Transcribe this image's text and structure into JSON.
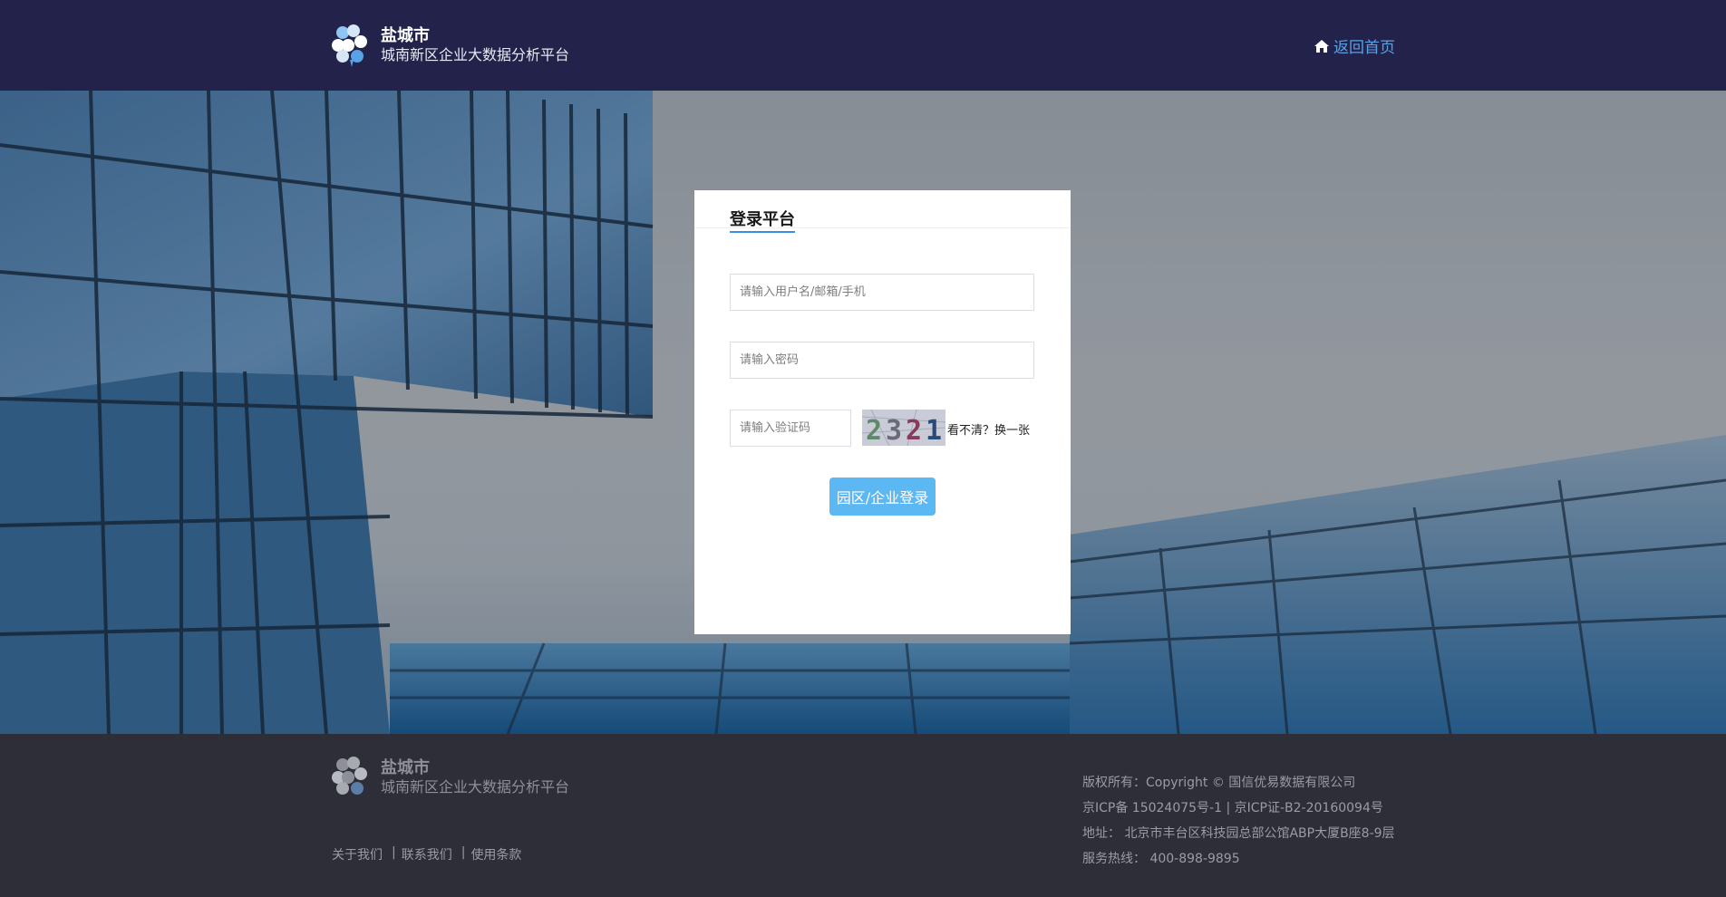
{
  "header": {
    "logo_title": "盐城市",
    "logo_subtitle": "城南新区企业大数据分析平台",
    "home_link": "返回首页"
  },
  "login": {
    "title": "登录平台",
    "username_placeholder": "请输入用户名/邮箱/手机",
    "password_placeholder": "请输入密码",
    "captcha_placeholder": "请输入验证码",
    "captcha_text": "2321",
    "refresh_text": "看不清？换一张",
    "submit_label": "园区/企业登录"
  },
  "footer": {
    "logo_title": "盐城市",
    "logo_subtitle": "城南新区企业大数据分析平台",
    "links": [
      "关于我们",
      "联系我们",
      "使用条款"
    ],
    "copyright": "版权所有：Copyright © 国信优易数据有限公司",
    "icp": "京ICP备 15024075号-1 | 京ICP证-B2-20160094号",
    "address": "地址： 北京市丰台区科技园总部公馆ABP大厦B座8-9层",
    "hotline": "服务热线： 400-898-9895"
  },
  "colors": {
    "header_bg": "#22224a",
    "accent": "#3a8ee6",
    "button_bg": "#5cb8f2",
    "footer_bg": "#2d2e38"
  }
}
